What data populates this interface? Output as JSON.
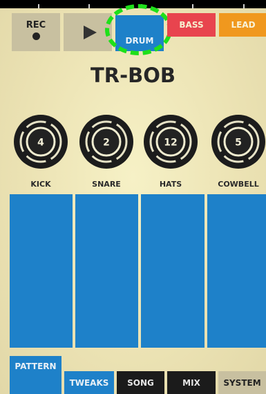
{
  "transport": {
    "rec_label": "REC",
    "play_icon": "play-icon",
    "record_icon": "record-dot-icon"
  },
  "instruments": [
    {
      "label": "DRUM",
      "color": "#1e81c9",
      "selected": true
    },
    {
      "label": "BASS",
      "color": "#e8444e"
    },
    {
      "label": "LEAD",
      "color": "#f0981e"
    }
  ],
  "machine_title": "TR-BOB",
  "knobs": [
    {
      "label": "KICK",
      "value": "4"
    },
    {
      "label": "SNARE",
      "value": "2"
    },
    {
      "label": "HATS",
      "value": "12"
    },
    {
      "label": "COWBELL",
      "value": "5"
    }
  ],
  "pad_count": 4,
  "bottom_tabs": [
    {
      "label": "PATTERN",
      "active": true
    },
    {
      "label": "TWEAKS"
    },
    {
      "label": "SONG"
    },
    {
      "label": "MIX"
    },
    {
      "label": "SYSTEM"
    }
  ],
  "colors": {
    "accent_blue": "#1e81c9",
    "highlight_green": "#1fe01a",
    "bass_red": "#e8444e",
    "lead_orange": "#f0981e"
  }
}
